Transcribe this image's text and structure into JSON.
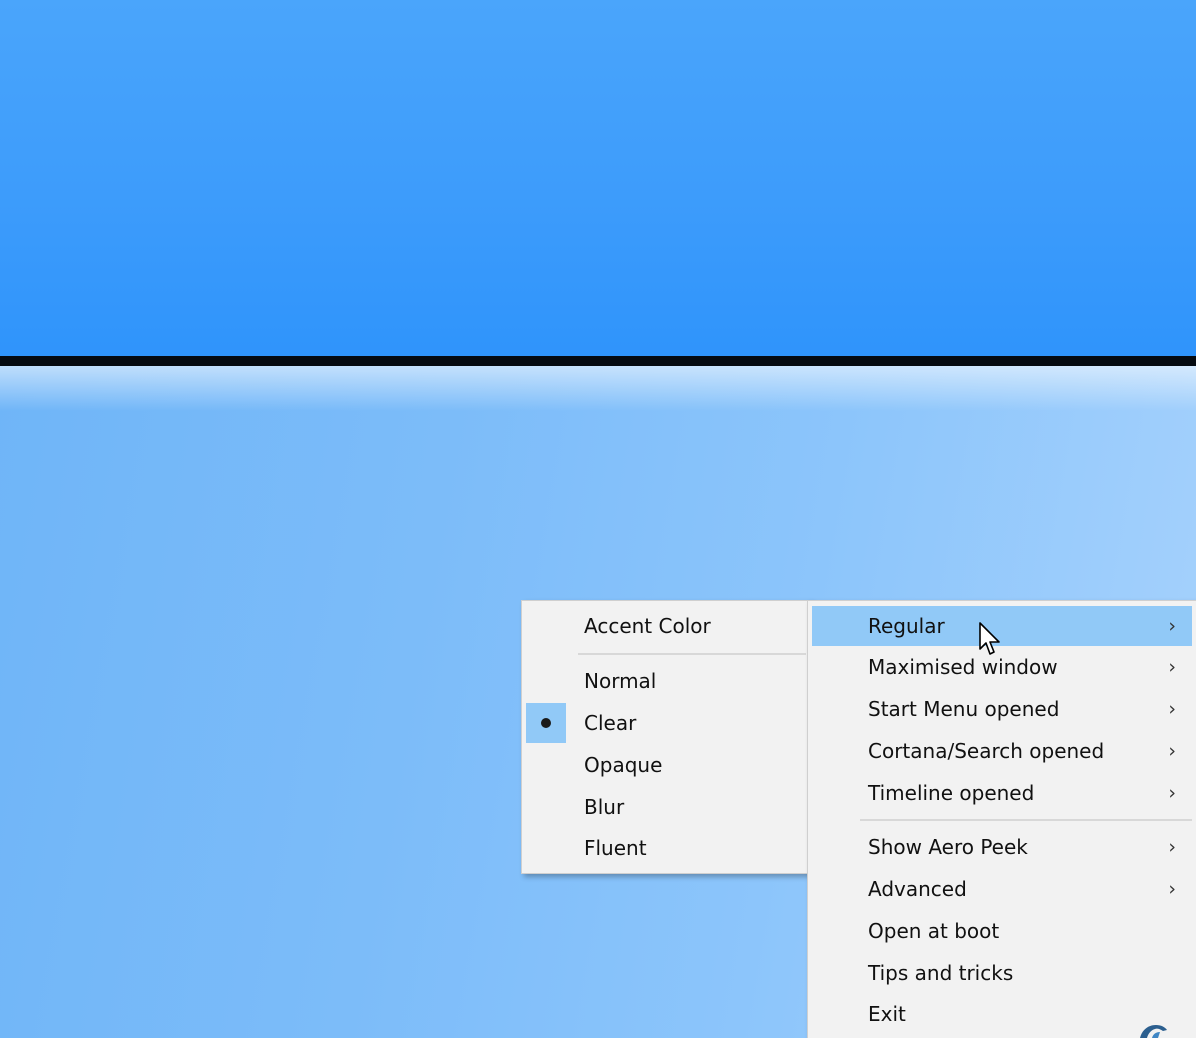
{
  "left_menu": {
    "header": "Accent Color",
    "options": [
      {
        "label": "Normal",
        "checked": false
      },
      {
        "label": "Clear",
        "checked": true
      },
      {
        "label": "Opaque",
        "checked": false
      },
      {
        "label": "Blur",
        "checked": false
      },
      {
        "label": "Fluent",
        "checked": false
      }
    ]
  },
  "right_menu": {
    "items": [
      {
        "label": "Regular",
        "submenu": true,
        "highlighted": true
      },
      {
        "label": "Maximised window",
        "submenu": true
      },
      {
        "label": "Start Menu opened",
        "submenu": true
      },
      {
        "label": "Cortana/Search opened",
        "submenu": true
      },
      {
        "label": "Timeline opened",
        "submenu": true
      },
      {
        "label": "Show Aero Peek",
        "submenu": true
      },
      {
        "label": "Advanced",
        "submenu": true
      },
      {
        "label": "Open at boot",
        "submenu": false
      },
      {
        "label": "Tips and tricks",
        "submenu": false
      },
      {
        "label": "Exit",
        "submenu": false
      }
    ],
    "arrow_glyph": "›"
  },
  "colors": {
    "menu_bg": "#f2f2f2",
    "highlight": "#91c9f7",
    "desktop_top": "#3d9cfb",
    "desktop_bottom": "#7fbef9"
  },
  "icons": {
    "cursor": "mouse-pointer-icon",
    "radio": "radio-dot-icon",
    "submenu": "chevron-right-icon",
    "tray": "app-logo-icon"
  }
}
